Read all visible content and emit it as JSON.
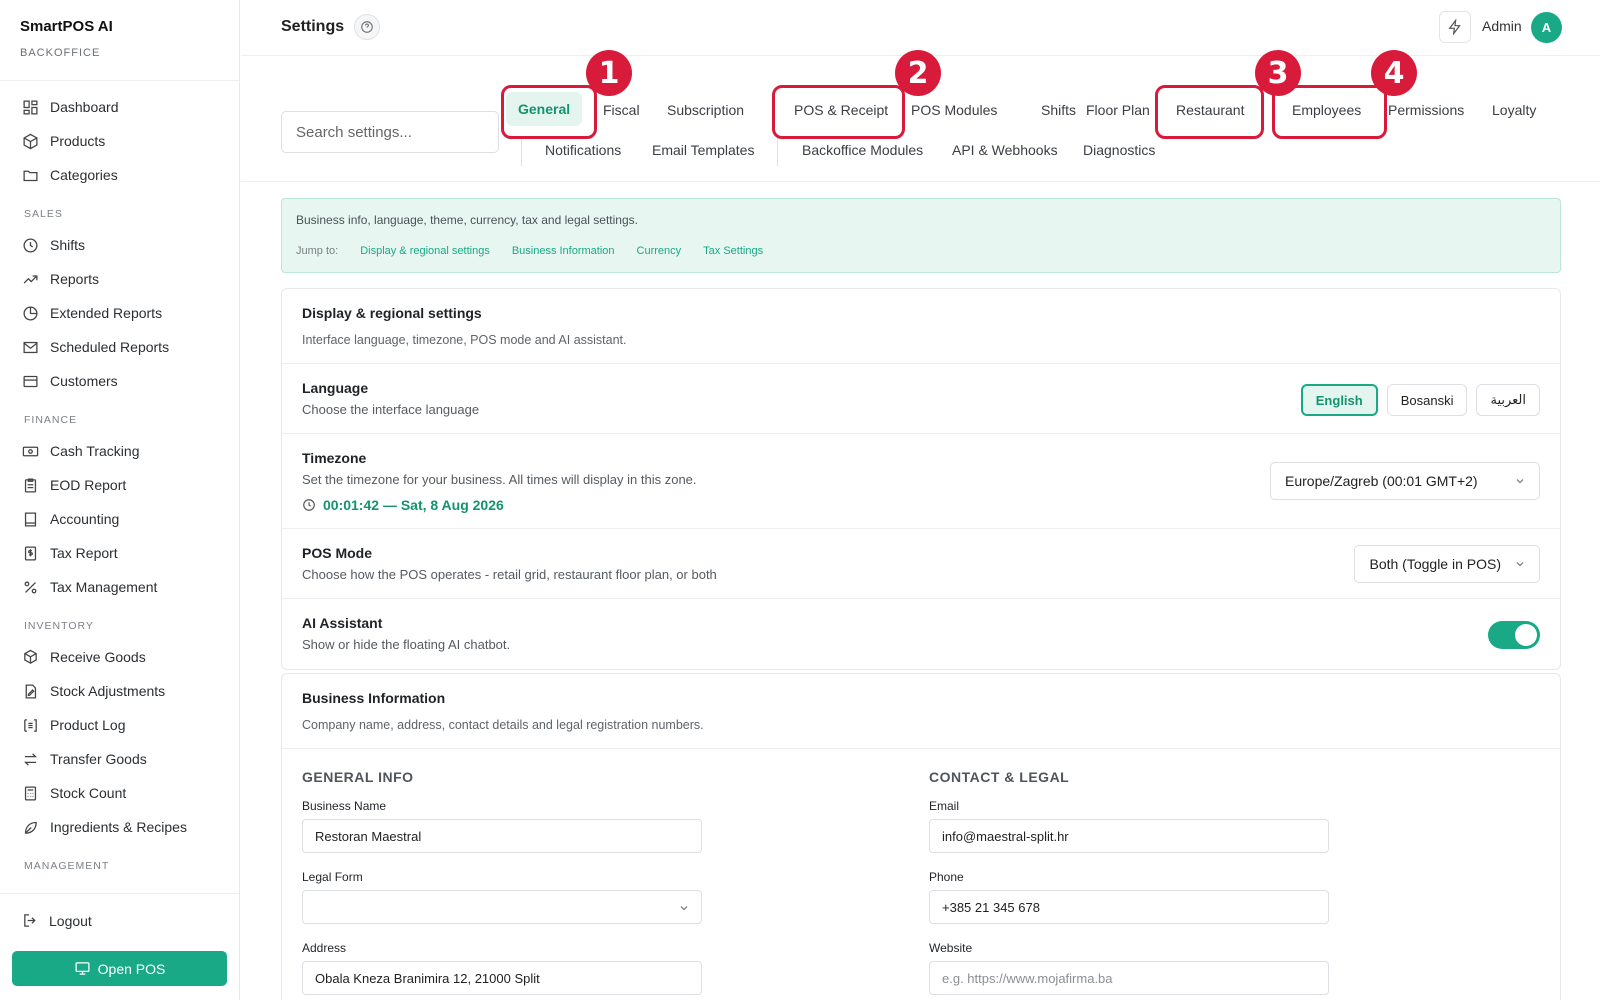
{
  "brand": {
    "title": "SmartPOS AI",
    "subtitle": "BACKOFFICE"
  },
  "sidebar": {
    "top": [
      {
        "label": "Dashboard",
        "icon": "dashboard-icon"
      },
      {
        "label": "Products",
        "icon": "box-icon"
      },
      {
        "label": "Categories",
        "icon": "folder-icon"
      }
    ],
    "sections": [
      {
        "title": "SALES",
        "items": [
          {
            "label": "Shifts",
            "icon": "clock-icon"
          },
          {
            "label": "Reports",
            "icon": "trend-icon"
          },
          {
            "label": "Extended Reports",
            "icon": "pie-icon"
          },
          {
            "label": "Scheduled Reports",
            "icon": "mail-icon"
          },
          {
            "label": "Customers",
            "icon": "card-icon"
          }
        ]
      },
      {
        "title": "FINANCE",
        "items": [
          {
            "label": "Cash Tracking",
            "icon": "cash-icon"
          },
          {
            "label": "EOD Report",
            "icon": "clipboard-icon"
          },
          {
            "label": "Accounting",
            "icon": "book-icon"
          },
          {
            "label": "Tax Report",
            "icon": "dollar-doc-icon"
          },
          {
            "label": "Tax Management",
            "icon": "percent-icon"
          }
        ]
      },
      {
        "title": "INVENTORY",
        "items": [
          {
            "label": "Receive Goods",
            "icon": "package-plus-icon"
          },
          {
            "label": "Stock Adjustments",
            "icon": "file-edit-icon"
          },
          {
            "label": "Product Log",
            "icon": "list-icon"
          },
          {
            "label": "Transfer Goods",
            "icon": "transfer-icon"
          },
          {
            "label": "Stock Count",
            "icon": "calculator-icon"
          },
          {
            "label": "Ingredients & Recipes",
            "icon": "leaf-icon"
          }
        ]
      },
      {
        "title": "MANAGEMENT",
        "items": []
      }
    ],
    "logout": "Logout",
    "open_pos": "Open POS"
  },
  "header": {
    "title": "Settings",
    "user": "Admin",
    "avatar": "A"
  },
  "search": {
    "placeholder": "Search settings..."
  },
  "tabs": {
    "row1": [
      "General",
      "Fiscal",
      "Subscription",
      "POS & Receipt",
      "POS Modules",
      "Shifts",
      "Floor Plan",
      "Restaurant",
      "Employees",
      "Permissions",
      "Loyalty"
    ],
    "row2": [
      "Notifications",
      "Email Templates",
      "Backoffice Modules",
      "API & Webhooks",
      "Diagnostics"
    ],
    "active": "General"
  },
  "annotations": [
    "1",
    "2",
    "3",
    "4"
  ],
  "banner": {
    "text": "Business info, language, theme, currency, tax and legal settings.",
    "jump_label": "Jump to:",
    "links": [
      "Display & regional settings",
      "Business Information",
      "Currency",
      "Tax Settings"
    ]
  },
  "display": {
    "title": "Display & regional settings",
    "desc": "Interface language, timezone, POS mode and AI assistant.",
    "language": {
      "title": "Language",
      "desc": "Choose the interface language",
      "options": [
        "English",
        "Bosanski",
        "العربية"
      ],
      "selected": "English"
    },
    "timezone": {
      "title": "Timezone",
      "desc": "Set the timezone for your business. All times will display in this zone.",
      "clock": "00:01:42 — Sat, 8 Aug 2026",
      "value": "Europe/Zagreb (00:01 GMT+2)"
    },
    "pos_mode": {
      "title": "POS Mode",
      "desc": "Choose how the POS operates - retail grid, restaurant floor plan, or both",
      "value": "Both (Toggle in POS)"
    },
    "ai": {
      "title": "AI Assistant",
      "desc": "Show or hide the floating AI chatbot.",
      "enabled": true
    }
  },
  "business": {
    "title": "Business Information",
    "desc": "Company name, address, contact details and legal registration numbers.",
    "general": {
      "heading": "GENERAL INFO",
      "name_label": "Business Name",
      "name_value": "Restoran Maestral",
      "legal_label": "Legal Form",
      "legal_value": "",
      "address_label": "Address",
      "address_value": "Obala Kneza Branimira 12, 21000 Split"
    },
    "contact": {
      "heading": "CONTACT & LEGAL",
      "email_label": "Email",
      "email_value": "info@maestral-split.hr",
      "phone_label": "Phone",
      "phone_value": "+385 21 345 678",
      "website_label": "Website",
      "website_placeholder": "e.g. https://www.mojafirma.ba"
    }
  },
  "colors": {
    "accent": "#1aa987",
    "annotation": "#d81b3b"
  }
}
